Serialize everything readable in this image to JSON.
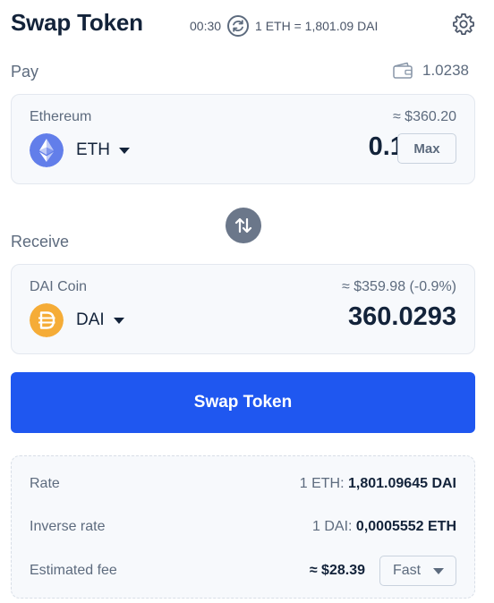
{
  "header": {
    "title": "Swap Token",
    "timer": "00:30",
    "rate_summary": "1 ETH = 1,801.09 DAI"
  },
  "pay": {
    "label": "Pay",
    "balance": "1.0238",
    "asset_name": "Ethereum",
    "usd_value": "≈ $360.20",
    "token_symbol": "ETH",
    "amount": "0.1",
    "max_label": "Max"
  },
  "receive": {
    "label": "Receive",
    "asset_name": "DAI Coin",
    "usd_value": "≈ $359.98 (-0.9%)",
    "token_symbol": "DAI",
    "amount": "360.0293"
  },
  "swap_button_label": "Swap Token",
  "details": {
    "rate_label": "Rate",
    "rate_prefix": "1 ETH:",
    "rate_value": "1,801.09645 DAI",
    "inverse_label": "Inverse rate",
    "inverse_prefix": "1 DAI:",
    "inverse_value": "0,0005552 ETH",
    "fee_label": "Estimated fee",
    "fee_value": "≈ $28.39",
    "fee_speed": "Fast"
  },
  "colors": {
    "primary": "#1f57f0",
    "eth_logo": "#627eea",
    "dai_logo": "#f5ac37",
    "swap_toggle": "#6b778a"
  },
  "icons": {
    "refresh": "refresh-icon",
    "settings": "gear-icon",
    "wallet": "wallet-icon",
    "eth": "eth-logo-icon",
    "dai": "dai-logo-icon",
    "swap": "swap-arrows-icon"
  }
}
